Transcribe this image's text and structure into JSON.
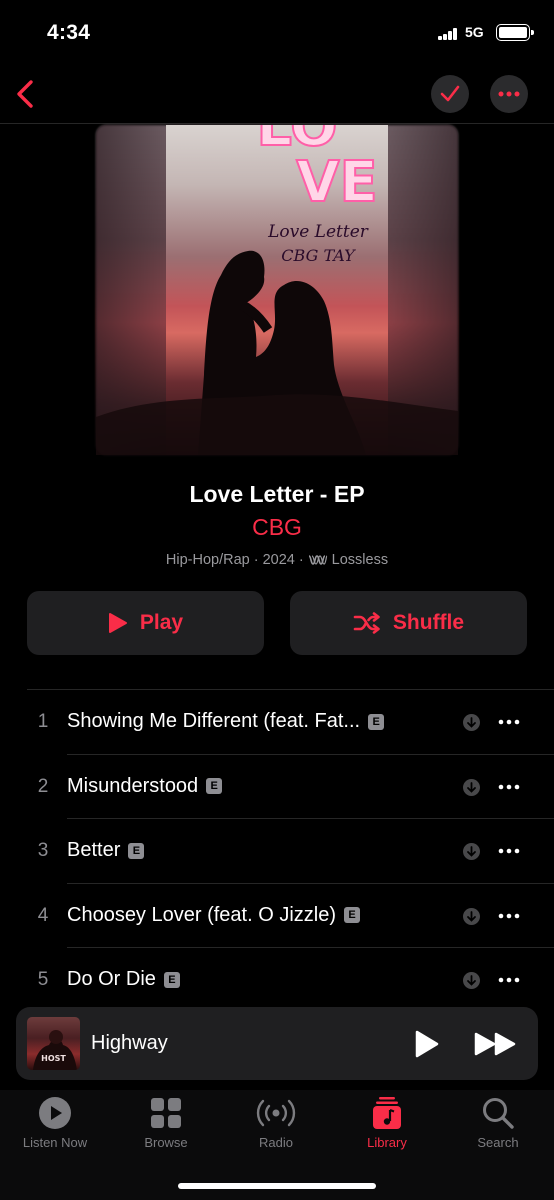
{
  "status": {
    "time": "4:34",
    "network": "5G"
  },
  "nav": {
    "back_icon": "chevron-left-icon",
    "check_icon": "checkmark-icon",
    "more_icon": "ellipsis-icon"
  },
  "artwork": {
    "line1": "LO",
    "line2": "VE",
    "script1": "Love Letter",
    "script2": "CBG TAY"
  },
  "album": {
    "title": "Love Letter - EP",
    "artist": "CBG",
    "genre": "Hip-Hop/Rap",
    "year": "2024",
    "quality": "Lossless",
    "separator": "·"
  },
  "actions": {
    "play_label": "Play",
    "shuffle_label": "Shuffle"
  },
  "tracks": [
    {
      "number": "1",
      "title": "Showing Me Different (feat. Fat...",
      "explicit": "E"
    },
    {
      "number": "2",
      "title": "Misunderstood",
      "explicit": "E"
    },
    {
      "number": "3",
      "title": "Better",
      "explicit": "E"
    },
    {
      "number": "4",
      "title": "Choosey Lover (feat. O Jizzle)",
      "explicit": "E"
    },
    {
      "number": "5",
      "title": "Do Or Die",
      "explicit": "E"
    }
  ],
  "mini_player": {
    "title": "Highway",
    "art_text": "HOST"
  },
  "tabs": [
    {
      "label": "Listen Now",
      "icon": "play-circle-icon"
    },
    {
      "label": "Browse",
      "icon": "grid-icon"
    },
    {
      "label": "Radio",
      "icon": "radio-icon"
    },
    {
      "label": "Library",
      "icon": "music-note-icon",
      "active": true
    },
    {
      "label": "Search",
      "icon": "search-icon"
    }
  ],
  "colors": {
    "accent": "#fa2d48",
    "background": "#000000",
    "surface": "#1f1f21",
    "secondary_text": "#8e8e93"
  }
}
